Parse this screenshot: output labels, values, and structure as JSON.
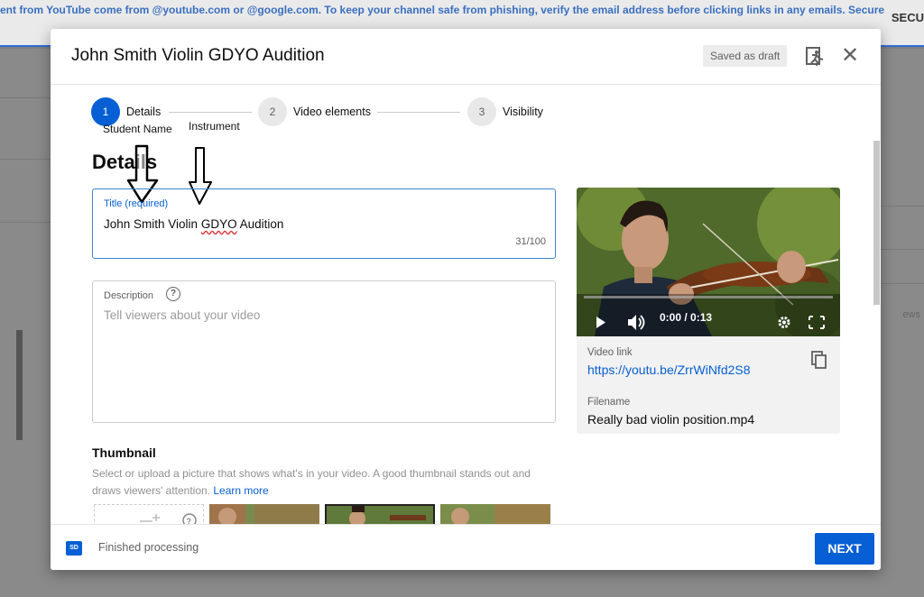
{
  "background": {
    "banner_text": "ent from YouTube come from @youtube.com or @google.com. To keep your channel safe from phishing, verify the email address before clicking links in any emails. Secure",
    "right_label": "SECU",
    "views_text": "ews"
  },
  "modal": {
    "title": "John Smith Violin GDYO Audition",
    "draft_label": "Saved as draft",
    "help_icon": "feedback-icon",
    "close_icon": "close-icon"
  },
  "stepper": {
    "steps": [
      {
        "number": "1",
        "label": "Details",
        "active": true
      },
      {
        "number": "2",
        "label": "Video elements",
        "active": false
      },
      {
        "number": "3",
        "label": "Visibility",
        "active": false
      }
    ]
  },
  "annotations": {
    "student_name": "Student Name",
    "instrument": "Instrument"
  },
  "details": {
    "heading": "Details",
    "title_field": {
      "label": "Title (required)",
      "value_before": "John Smith Violin ",
      "value_flagged": "GDYO",
      "value_after": " Audition",
      "count": "31/100"
    },
    "description_field": {
      "label": "Description",
      "placeholder": "Tell viewers about your video"
    },
    "thumbnail": {
      "heading": "Thumbnail",
      "description": "Select or upload a picture that shows what's in your video. A good thumbnail stands out and draws viewers' attention.",
      "learn_more": "Learn more"
    }
  },
  "video": {
    "time": "0:00 / 0:13",
    "link_label": "Video link",
    "link": "https://youtu.be/ZrrWiNfd2S8",
    "filename_label": "Filename",
    "filename": "Really bad violin position.mp4"
  },
  "footer": {
    "badge": "SD",
    "status": "Finished processing",
    "next_label": "NEXT"
  },
  "colors": {
    "accent": "#065fd4",
    "title_border": "#3a86d8"
  }
}
